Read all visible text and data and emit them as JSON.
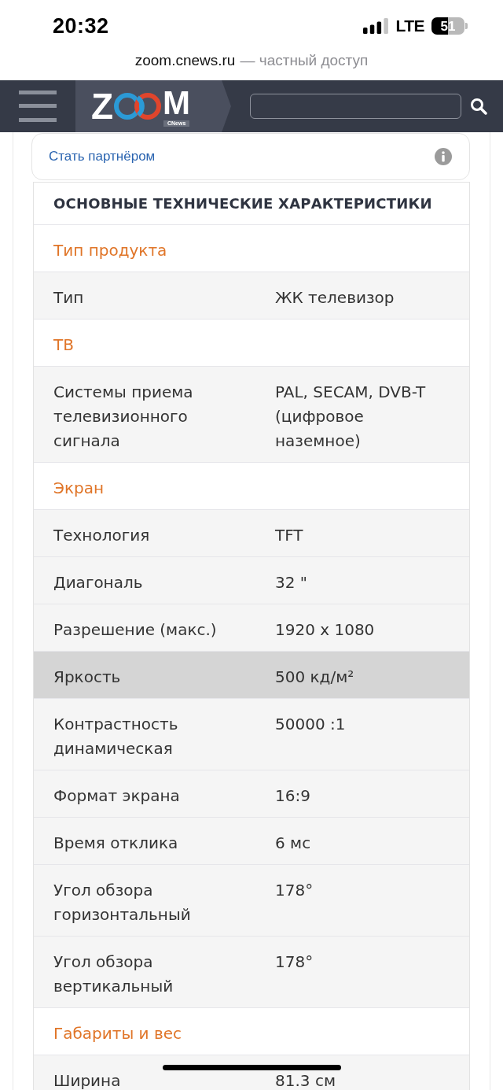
{
  "status_bar": {
    "time": "20:32",
    "network": "LTE",
    "battery": "51"
  },
  "address_bar": {
    "domain": "zoom.cnews.ru",
    "note": "— частный доступ"
  },
  "header": {
    "logo": {
      "first_letter": "Z",
      "last_letter": "M",
      "tagline": "CNews"
    }
  },
  "partner_card": {
    "link": "Стать партнёром"
  },
  "specs": {
    "title": "ОСНОВНЫЕ ТЕХНИЧЕСКИЕ ХАРАКТЕРИСТИКИ",
    "rows": [
      {
        "kind": "section",
        "label": "Тип продукта"
      },
      {
        "kind": "spec",
        "label": "Тип",
        "value": "ЖК телевизор",
        "highlighted": false
      },
      {
        "kind": "section",
        "label": "ТВ"
      },
      {
        "kind": "spec",
        "label": "Системы приема телевизионного сигнала",
        "value": "PAL, SECAM, DVB-T (цифровое наземное)",
        "highlighted": false
      },
      {
        "kind": "section",
        "label": "Экран"
      },
      {
        "kind": "spec",
        "label": "Технология",
        "value": "TFT",
        "highlighted": false
      },
      {
        "kind": "spec",
        "label": "Диагональ",
        "value": "32 \"",
        "highlighted": false
      },
      {
        "kind": "spec",
        "label": "Разрешение (макс.)",
        "value": "1920 x 1080",
        "highlighted": false
      },
      {
        "kind": "spec",
        "label": "Яркость",
        "value": "500 кд/м²",
        "highlighted": true
      },
      {
        "kind": "spec",
        "label": "Контрастность динамическая",
        "value": "50000 :1",
        "highlighted": false
      },
      {
        "kind": "spec",
        "label": "Формат экрана",
        "value": "16:9",
        "highlighted": false
      },
      {
        "kind": "spec",
        "label": "Время отклика",
        "value": "6 мс",
        "highlighted": false
      },
      {
        "kind": "spec",
        "label": "Угол обзора горизонтальный",
        "value": "178°",
        "highlighted": false
      },
      {
        "kind": "spec",
        "label": "Угол обзора вертикальный",
        "value": "178°",
        "highlighted": false
      },
      {
        "kind": "section",
        "label": "Габариты и вес"
      },
      {
        "kind": "spec",
        "label": "Ширина",
        "value": "81.3 см",
        "highlighted": false
      }
    ]
  }
}
